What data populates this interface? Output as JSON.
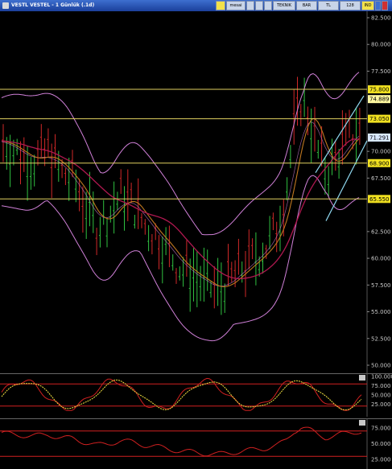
{
  "window": {
    "title": "VESTL VESTEL - 1 Günlük (.1d)"
  },
  "toolbar": {
    "buttons": [
      {
        "label": "",
        "icon": "chart-icon"
      },
      {
        "label": "mesai",
        "icon": ""
      },
      {
        "label": "",
        "icon": "wrench-icon"
      },
      {
        "label": "",
        "icon": "pen-icon"
      },
      {
        "label": "",
        "icon": "grid-icon"
      },
      {
        "label": "TEKNIK",
        "icon": ""
      },
      {
        "label": "BAR",
        "icon": ""
      },
      {
        "label": "TL",
        "icon": ""
      },
      {
        "label": "128",
        "icon": ""
      },
      {
        "label": "IND",
        "icon": ""
      }
    ]
  },
  "colors": {
    "background": "#000000",
    "level_line": "#e0d060",
    "channel": "#8fd8f0",
    "bollinger": "#d080d8",
    "ma_fast": "#c07820",
    "ma_slow": "#b01850",
    "stoch_k": "#d02020",
    "stoch_d": "#f0e040"
  },
  "price_axis": {
    "ticks": [
      "82.500",
      "80.000",
      "77.500",
      "75.800",
      "74.889",
      "73.050",
      "71.291",
      "70.000",
      "68.900",
      "67.500",
      "65.550",
      "62.500",
      "60.000",
      "57.500",
      "55.000",
      "52.500",
      "50.000"
    ]
  },
  "levels": [
    {
      "label": "75.800",
      "value": 75.8
    },
    {
      "label": "73.050",
      "value": 73.05
    },
    {
      "label": "68.900",
      "value": 68.9
    },
    {
      "label": "65.550",
      "value": 65.55
    }
  ],
  "last_price": {
    "label": "74.889",
    "value": 74.889
  },
  "price2": {
    "label": "71.291",
    "value": 71.291
  },
  "stochastic": {
    "ticks": [
      "100.000",
      "75.000",
      "50.000",
      "25.000"
    ],
    "upper_band": 80,
    "lower_band": 20
  },
  "rsi": {
    "ticks": [
      "75.000",
      "50.000",
      "25.000"
    ]
  }
}
